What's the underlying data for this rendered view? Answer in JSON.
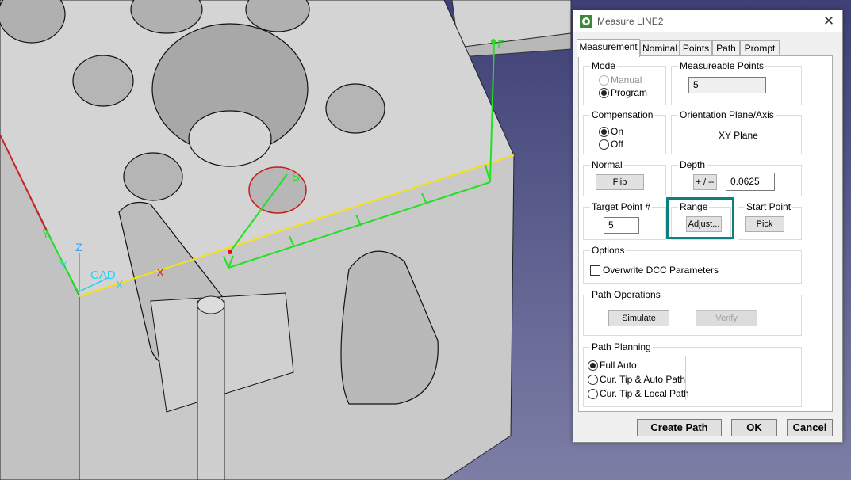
{
  "viewport": {
    "background_color": "#4a4c7c",
    "cad_label": "CAD",
    "axis_labels": {
      "x": "X",
      "y_top": "Y",
      "y": "Y",
      "z": "Z"
    },
    "start_marker": "S",
    "end_marker": "E",
    "cross_marker": "X"
  },
  "dialog": {
    "title": "Measure LINE2",
    "tabs": [
      "Measurement",
      "Nominal",
      "Points",
      "Path",
      "Prompt"
    ],
    "mode": {
      "label": "Mode",
      "manual": "Manual",
      "program": "Program",
      "selected": "Program"
    },
    "measurable_points": {
      "label": "Measureable Points",
      "value": "5"
    },
    "compensation": {
      "label": "Compensation",
      "on": "On",
      "off": "Off",
      "selected": "On"
    },
    "orientation": {
      "label": "Orientation Plane/Axis",
      "value": "XY Plane"
    },
    "normal": {
      "label": "Normal",
      "flip": "Flip"
    },
    "depth": {
      "label": "Depth",
      "toggle": "+ / --",
      "value": "0.0625"
    },
    "target_point": {
      "label": "Target Point #",
      "value": "5"
    },
    "range": {
      "label": "Range",
      "adjust": "Adjust..."
    },
    "start_point": {
      "label": "Start Point",
      "pick": "Pick"
    },
    "options": {
      "label": "Options",
      "overwrite": "Overwrite DCC Parameters",
      "overwrite_checked": false
    },
    "path_operations": {
      "label": "Path Operations",
      "simulate": "Simulate",
      "verify": "Verify"
    },
    "path_planning": {
      "label": "Path Planning",
      "full_auto": "Full Auto",
      "tip_auto": "Cur. Tip & Auto Path",
      "tip_local": "Cur. Tip & Local Path",
      "selected": "Full Auto"
    },
    "buttons": {
      "create_path": "Create Path",
      "ok": "OK",
      "cancel": "Cancel"
    },
    "highlight_color": "#0e7f7f"
  }
}
